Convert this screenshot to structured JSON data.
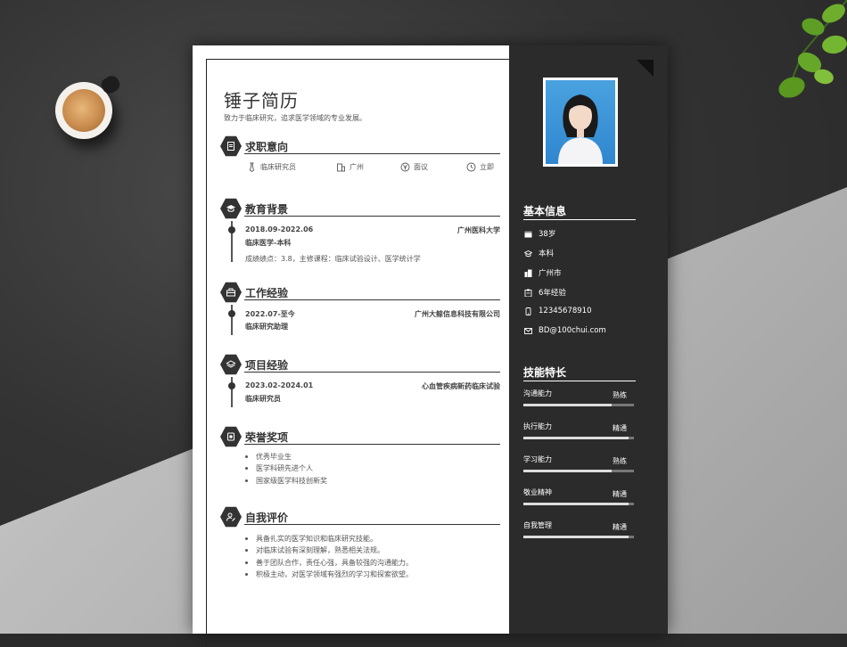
{
  "resume": {
    "name": "锤子简历",
    "tagline": "致力于临床研究，追求医学领域的专业发展。"
  },
  "sections": {
    "intent": {
      "title": "求职意向",
      "items": [
        {
          "icon": "tie-icon",
          "label": "临床研究员"
        },
        {
          "icon": "building-icon",
          "label": "广州"
        },
        {
          "icon": "yen-icon",
          "label": "面议"
        },
        {
          "icon": "clock-icon",
          "label": "立即"
        }
      ]
    },
    "education": {
      "title": "教育背景",
      "date": "2018.09-2022.06",
      "org": "广州医科大学",
      "role": "临床医学-本科",
      "desc": "成绩绩点：3.8，主修课程：临床试验设计、医学统计学"
    },
    "work": {
      "title": "工作经验",
      "date": "2022.07-至今",
      "org": "广州大鲸信息科技有限公司",
      "role": "临床研究助理"
    },
    "project": {
      "title": "项目经验",
      "date": "2023.02-2024.01",
      "org": "心血管疾病新药临床试验",
      "role": "临床研究员"
    },
    "awards": {
      "title": "荣誉奖项",
      "items": [
        "优秀毕业生",
        "医学科研先进个人",
        "国家级医学科技创新奖"
      ]
    },
    "self": {
      "title": "自我评价",
      "items": [
        "具备扎实的医学知识和临床研究技能。",
        "对临床试验有深刻理解，熟悉相关法规。",
        "善于团队合作，责任心强，具备较强的沟通能力。",
        "积极主动，对医学领域有强烈的学习和探索欲望。"
      ]
    }
  },
  "sidebar": {
    "basic_title": "基本信息",
    "basic": [
      {
        "icon": "calendar-icon",
        "value": "38岁"
      },
      {
        "icon": "graduation-icon",
        "value": "本科"
      },
      {
        "icon": "city-icon",
        "value": "广州市"
      },
      {
        "icon": "clipboard-icon",
        "value": "6年经验"
      },
      {
        "icon": "phone-icon",
        "value": "12345678910"
      },
      {
        "icon": "mail-icon",
        "value": "BD@100chui.com"
      }
    ],
    "skills_title": "技能特长",
    "skills": [
      {
        "name": "沟通能力",
        "level": "熟练",
        "fill": 0.8
      },
      {
        "name": "执行能力",
        "level": "精通",
        "fill": 0.95
      },
      {
        "name": "学习能力",
        "level": "熟练",
        "fill": 0.8
      },
      {
        "name": "敬业精神",
        "level": "精通",
        "fill": 0.95
      },
      {
        "name": "自我管理",
        "level": "精通",
        "fill": 0.95
      }
    ]
  },
  "colors": {
    "dark_panel": "#2b2b2b",
    "accent": "#333333"
  }
}
